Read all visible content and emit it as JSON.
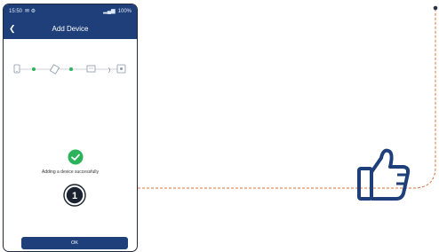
{
  "statusbar": {
    "left": "15:50",
    "right": "100%"
  },
  "navbar": {
    "back_icon": "chevron-left-icon",
    "title": "Add Device"
  },
  "steps": {
    "icons": [
      "device-icon",
      "link-icon",
      "router-icon",
      "signal-icon",
      "screen-icon"
    ],
    "current_color": "#2ab35a",
    "line_color": "#9aa4b1"
  },
  "content": {
    "success_icon": "check-circle-icon",
    "message": "Adding a device successfully"
  },
  "callout": {
    "number": "1"
  },
  "actions": {
    "ok_label": "OK"
  },
  "colors": {
    "brand": "#1e3f7a",
    "success": "#2ab35a",
    "connector": "#e0703b"
  },
  "illustration": {
    "icon": "thumbs-up-icon"
  }
}
